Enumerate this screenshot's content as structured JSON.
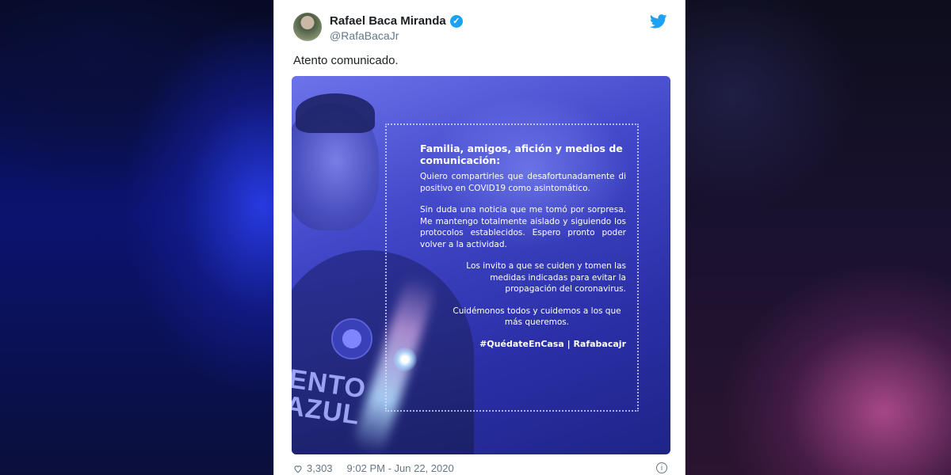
{
  "tweet": {
    "author_name": "Rafael Baca Miranda",
    "handle": "@RafaBacaJr",
    "text": "Atento comunicado.",
    "likes": "3,303",
    "timestamp": "9:02 PM - Jun 22, 2020",
    "info_symbol": "i"
  },
  "image": {
    "jersey_text": "ENTO\nAZUL",
    "title": "Familia, amigos, afición y medios de comunicación:",
    "paragraphs": [
      "Quiero compartirles que desafortunadamente di positivo en COVID19 como asintomático.",
      "Sin duda una noticia que me tomó por sorpresa. Me mantengo totalmente aislado y siguiendo los protocolos establecidos. Espero pronto poder volver a la actividad.",
      "Los invito a que se cuiden y tomen las medidas indicadas para evitar la propagación del coronavirus.",
      "Cuidémonos todos y cuidemos a los que más queremos."
    ],
    "hashtag": "#QuédateEnCasa | Rafabacajr"
  },
  "colors": {
    "twitter_blue": "#1da1f2",
    "text_primary": "#1c2022",
    "text_secondary": "#657786",
    "image_blue": "#3b41c2"
  },
  "icons": {
    "verified": "verified-badge-icon",
    "bird": "twitter-bird-icon",
    "heart": "heart-icon",
    "info": "info-icon"
  }
}
